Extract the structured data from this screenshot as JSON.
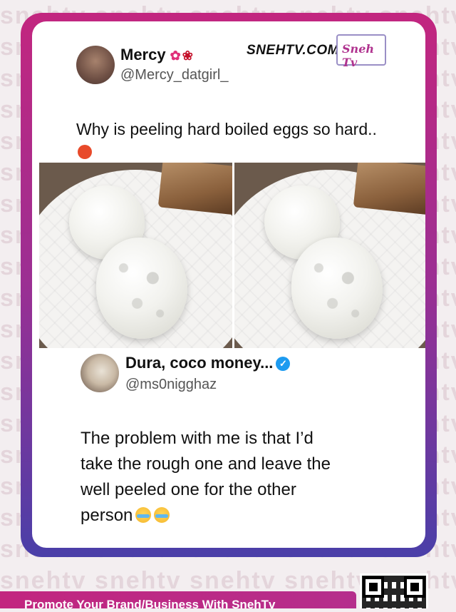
{
  "background_watermark": "snehtv snehtv snehtv snehtv snehtv",
  "tweet1": {
    "name": "Mercy",
    "handle": "@Mercy_datgirl_",
    "text": "Why is peeling hard boiled eggs so hard..",
    "emojis": [
      "hibiscus-emoji",
      "rose-emoji",
      "angry-face-emoji"
    ]
  },
  "brand": {
    "site": "SNEHTV.COM",
    "logo_text": "Sneh Tv"
  },
  "tweet2": {
    "name": "Dura, coco money...",
    "handle": "@ms0nigghaz",
    "verified": true,
    "text_lines": [
      "The problem with me is that I’d",
      "take the rough one and leave the",
      "well peeled one for the other",
      "person"
    ],
    "emojis": [
      "loudly-crying-emoji",
      "loudly-crying-emoji"
    ]
  },
  "footer": {
    "promo": "Promote Your Brand/Business With SnehTv"
  },
  "colors": {
    "frame_top": "#c2267f",
    "frame_bottom": "#4a3fa8",
    "verified": "#1d9bf0",
    "promo_bar": "#c2267f"
  }
}
